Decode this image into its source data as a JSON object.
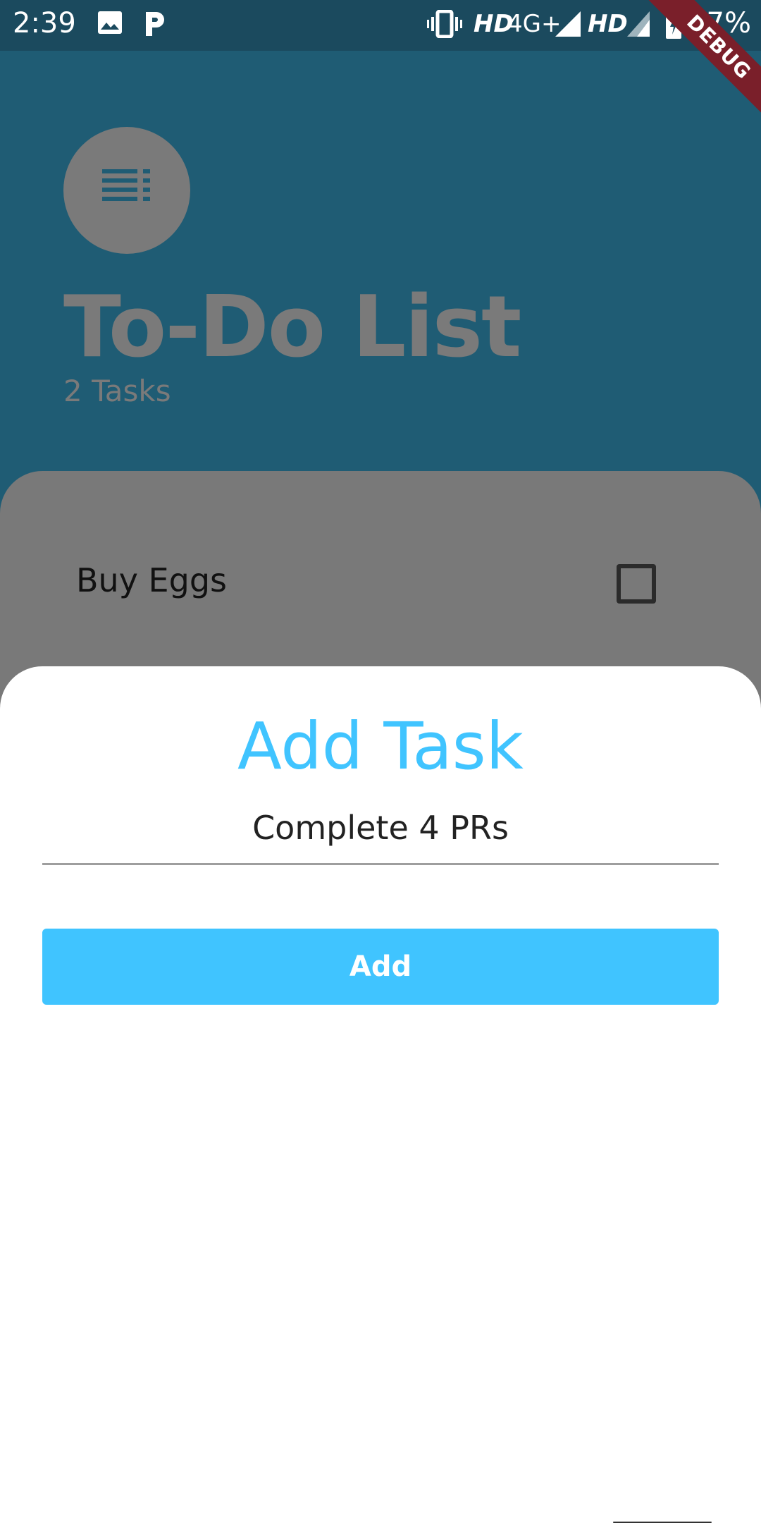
{
  "status_bar": {
    "time": "2:39",
    "network_label_1": "HD",
    "network_type": "4G+",
    "network_label_2": "HD",
    "battery": "87%",
    "icons": [
      "gallery-icon",
      "pandora-icon",
      "vibrate-icon",
      "signal-icon",
      "signal-icon",
      "battery-charging-icon"
    ]
  },
  "debug_banner": "DEBUG",
  "header": {
    "menu_icon": "list-menu-icon",
    "title": "To-Do List",
    "task_count": "2 Tasks"
  },
  "list": {
    "items": [
      {
        "label": "Buy Eggs",
        "checked": false
      }
    ]
  },
  "sheet": {
    "title": "Add Task",
    "input_value": "Complete 4 PRs",
    "button_label": "Add"
  },
  "colors": {
    "accent": "#40c4ff",
    "background": "#1f5c74",
    "scrim": "#797979",
    "debug": "#7a1f2a"
  }
}
